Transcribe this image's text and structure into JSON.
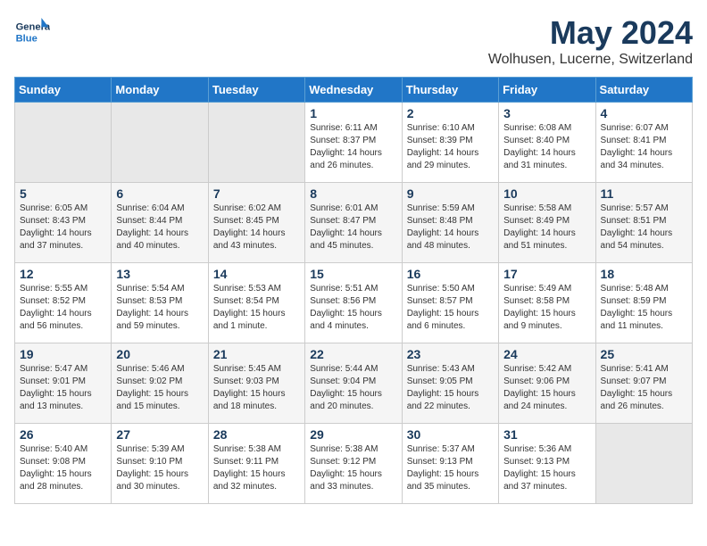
{
  "header": {
    "logo_line1": "General",
    "logo_line2": "Blue",
    "month_year": "May 2024",
    "location": "Wolhusen, Lucerne, Switzerland"
  },
  "weekdays": [
    "Sunday",
    "Monday",
    "Tuesday",
    "Wednesday",
    "Thursday",
    "Friday",
    "Saturday"
  ],
  "weeks": [
    [
      {
        "day": "",
        "content": ""
      },
      {
        "day": "",
        "content": ""
      },
      {
        "day": "",
        "content": ""
      },
      {
        "day": "1",
        "content": "Sunrise: 6:11 AM\nSunset: 8:37 PM\nDaylight: 14 hours\nand 26 minutes."
      },
      {
        "day": "2",
        "content": "Sunrise: 6:10 AM\nSunset: 8:39 PM\nDaylight: 14 hours\nand 29 minutes."
      },
      {
        "day": "3",
        "content": "Sunrise: 6:08 AM\nSunset: 8:40 PM\nDaylight: 14 hours\nand 31 minutes."
      },
      {
        "day": "4",
        "content": "Sunrise: 6:07 AM\nSunset: 8:41 PM\nDaylight: 14 hours\nand 34 minutes."
      }
    ],
    [
      {
        "day": "5",
        "content": "Sunrise: 6:05 AM\nSunset: 8:43 PM\nDaylight: 14 hours\nand 37 minutes."
      },
      {
        "day": "6",
        "content": "Sunrise: 6:04 AM\nSunset: 8:44 PM\nDaylight: 14 hours\nand 40 minutes."
      },
      {
        "day": "7",
        "content": "Sunrise: 6:02 AM\nSunset: 8:45 PM\nDaylight: 14 hours\nand 43 minutes."
      },
      {
        "day": "8",
        "content": "Sunrise: 6:01 AM\nSunset: 8:47 PM\nDaylight: 14 hours\nand 45 minutes."
      },
      {
        "day": "9",
        "content": "Sunrise: 5:59 AM\nSunset: 8:48 PM\nDaylight: 14 hours\nand 48 minutes."
      },
      {
        "day": "10",
        "content": "Sunrise: 5:58 AM\nSunset: 8:49 PM\nDaylight: 14 hours\nand 51 minutes."
      },
      {
        "day": "11",
        "content": "Sunrise: 5:57 AM\nSunset: 8:51 PM\nDaylight: 14 hours\nand 54 minutes."
      }
    ],
    [
      {
        "day": "12",
        "content": "Sunrise: 5:55 AM\nSunset: 8:52 PM\nDaylight: 14 hours\nand 56 minutes."
      },
      {
        "day": "13",
        "content": "Sunrise: 5:54 AM\nSunset: 8:53 PM\nDaylight: 14 hours\nand 59 minutes."
      },
      {
        "day": "14",
        "content": "Sunrise: 5:53 AM\nSunset: 8:54 PM\nDaylight: 15 hours\nand 1 minute."
      },
      {
        "day": "15",
        "content": "Sunrise: 5:51 AM\nSunset: 8:56 PM\nDaylight: 15 hours\nand 4 minutes."
      },
      {
        "day": "16",
        "content": "Sunrise: 5:50 AM\nSunset: 8:57 PM\nDaylight: 15 hours\nand 6 minutes."
      },
      {
        "day": "17",
        "content": "Sunrise: 5:49 AM\nSunset: 8:58 PM\nDaylight: 15 hours\nand 9 minutes."
      },
      {
        "day": "18",
        "content": "Sunrise: 5:48 AM\nSunset: 8:59 PM\nDaylight: 15 hours\nand 11 minutes."
      }
    ],
    [
      {
        "day": "19",
        "content": "Sunrise: 5:47 AM\nSunset: 9:01 PM\nDaylight: 15 hours\nand 13 minutes."
      },
      {
        "day": "20",
        "content": "Sunrise: 5:46 AM\nSunset: 9:02 PM\nDaylight: 15 hours\nand 15 minutes."
      },
      {
        "day": "21",
        "content": "Sunrise: 5:45 AM\nSunset: 9:03 PM\nDaylight: 15 hours\nand 18 minutes."
      },
      {
        "day": "22",
        "content": "Sunrise: 5:44 AM\nSunset: 9:04 PM\nDaylight: 15 hours\nand 20 minutes."
      },
      {
        "day": "23",
        "content": "Sunrise: 5:43 AM\nSunset: 9:05 PM\nDaylight: 15 hours\nand 22 minutes."
      },
      {
        "day": "24",
        "content": "Sunrise: 5:42 AM\nSunset: 9:06 PM\nDaylight: 15 hours\nand 24 minutes."
      },
      {
        "day": "25",
        "content": "Sunrise: 5:41 AM\nSunset: 9:07 PM\nDaylight: 15 hours\nand 26 minutes."
      }
    ],
    [
      {
        "day": "26",
        "content": "Sunrise: 5:40 AM\nSunset: 9:08 PM\nDaylight: 15 hours\nand 28 minutes."
      },
      {
        "day": "27",
        "content": "Sunrise: 5:39 AM\nSunset: 9:10 PM\nDaylight: 15 hours\nand 30 minutes."
      },
      {
        "day": "28",
        "content": "Sunrise: 5:38 AM\nSunset: 9:11 PM\nDaylight: 15 hours\nand 32 minutes."
      },
      {
        "day": "29",
        "content": "Sunrise: 5:38 AM\nSunset: 9:12 PM\nDaylight: 15 hours\nand 33 minutes."
      },
      {
        "day": "30",
        "content": "Sunrise: 5:37 AM\nSunset: 9:13 PM\nDaylight: 15 hours\nand 35 minutes."
      },
      {
        "day": "31",
        "content": "Sunrise: 5:36 AM\nSunset: 9:13 PM\nDaylight: 15 hours\nand 37 minutes."
      },
      {
        "day": "",
        "content": ""
      }
    ]
  ]
}
